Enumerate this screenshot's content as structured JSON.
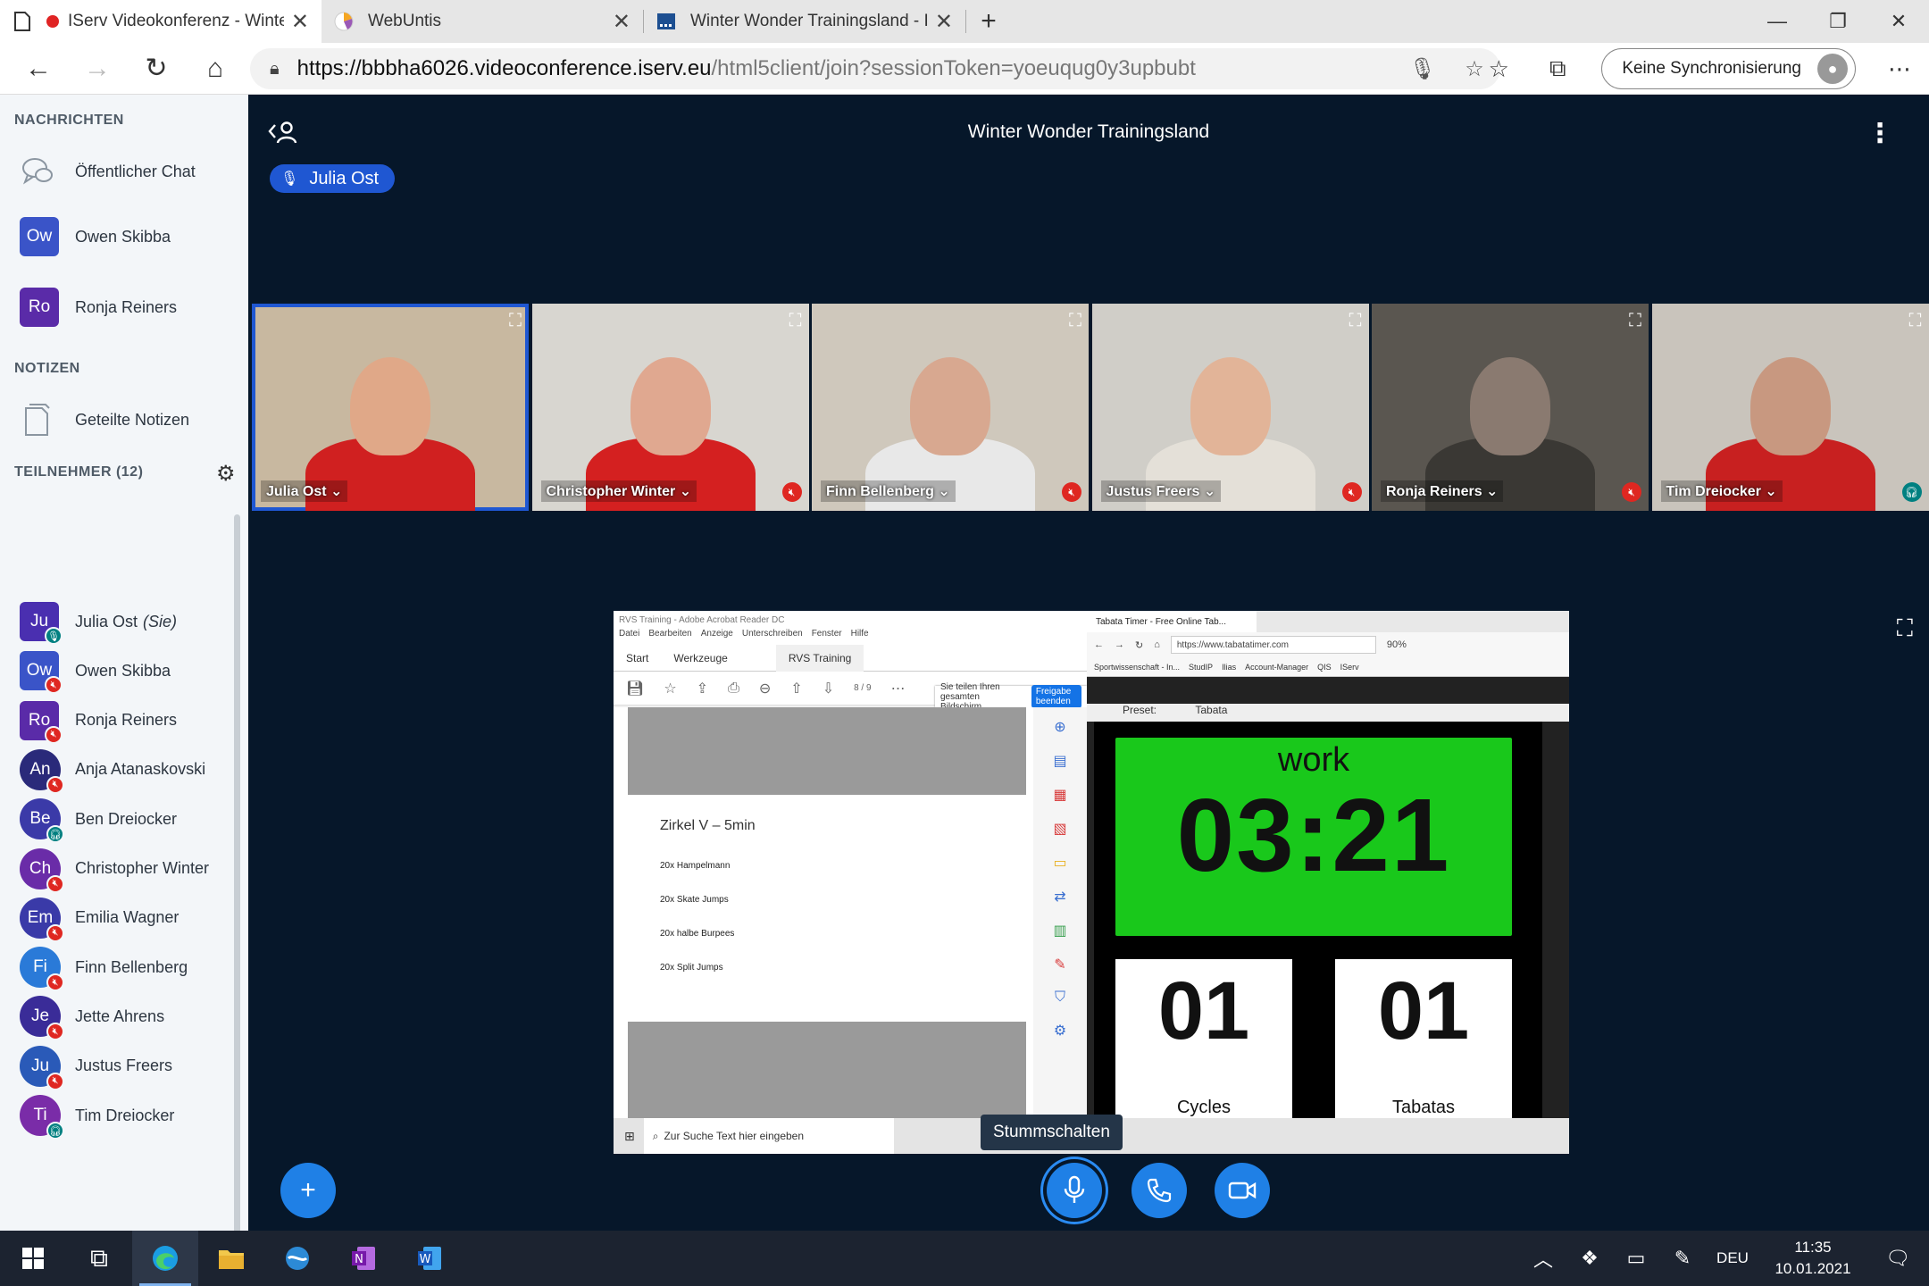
{
  "browser": {
    "tabs": [
      {
        "title": "IServ Videokonferenz - Winter Wonder Trainingsland",
        "active": true
      },
      {
        "title": "WebUntis",
        "active": false
      },
      {
        "title": "Winter Wonder Trainingsland - IServ",
        "active": false
      }
    ],
    "url_host": "https://bbbha6026.videoconference.iserv.eu",
    "url_path": "/html5client/join?sessionToken=yoeuqug0y3upbubt",
    "sync_label": "Keine Synchronisierung"
  },
  "sidebar": {
    "messages_title": "NACHRICHTEN",
    "public_chat": "Öffentlicher Chat",
    "private_chats": [
      {
        "initials": "Ow",
        "name": "Owen Skibba"
      },
      {
        "initials": "Ro",
        "name": "Ronja Reiners"
      }
    ],
    "notes_title": "NOTIZEN",
    "shared_notes": "Geteilte Notizen",
    "participants_title": "TEILNEHMER (12)",
    "participants": [
      {
        "initials": "Ju",
        "name": "Julia Ost",
        "suffix": "(Sie)",
        "color": "#4a2fb0",
        "shape": "square",
        "status": "mic"
      },
      {
        "initials": "Ow",
        "name": "Owen Skibba",
        "color": "#3a54c8",
        "shape": "square",
        "status": "mute"
      },
      {
        "initials": "Ro",
        "name": "Ronja Reiners",
        "color": "#5a2ba8",
        "shape": "square",
        "status": "mute"
      },
      {
        "initials": "An",
        "name": "Anja Atanaskovski",
        "color": "#2a2a7a",
        "shape": "circle",
        "status": "mute"
      },
      {
        "initials": "Be",
        "name": "Ben Dreiocker",
        "color": "#3b3aa8",
        "shape": "circle",
        "status": "head"
      },
      {
        "initials": "Ch",
        "name": "Christopher Winter",
        "color": "#6a2ca8",
        "shape": "circle",
        "status": "mute"
      },
      {
        "initials": "Em",
        "name": "Emilia Wagner",
        "color": "#3a3aa8",
        "shape": "circle",
        "status": "mute"
      },
      {
        "initials": "Fi",
        "name": "Finn Bellenberg",
        "color": "#2a7ad8",
        "shape": "circle",
        "status": "mute"
      },
      {
        "initials": "Je",
        "name": "Jette Ahrens",
        "color": "#3a2c98",
        "shape": "circle",
        "status": "mute"
      },
      {
        "initials": "Ju",
        "name": "Justus Freers",
        "color": "#2a5ab8",
        "shape": "circle",
        "status": "mute"
      },
      {
        "initials": "Ti",
        "name": "Tim Dreiocker",
        "color": "#7a2ca8",
        "shape": "circle",
        "status": "head"
      }
    ]
  },
  "main": {
    "room_title": "Winter Wonder Trainingsland",
    "talker": "Julia Ost",
    "videos": [
      {
        "name": "Julia Ost",
        "status": "none",
        "bg": "#c8b8a0",
        "shirt": "#d02020",
        "skin": "#e0a888",
        "speaking": true
      },
      {
        "name": "Christopher Winter",
        "status": "mute",
        "bg": "#d8d6d0",
        "shirt": "#d42020",
        "skin": "#e0a890",
        "speaking": false
      },
      {
        "name": "Finn Bellenberg",
        "status": "mute",
        "bg": "#cfc8bc",
        "shirt": "#e8e8e8",
        "skin": "#d8a890",
        "speaking": false
      },
      {
        "name": "Justus Freers",
        "status": "mute",
        "bg": "#d0cec8",
        "shirt": "#e4e0d8",
        "skin": "#e2b498",
        "speaking": false
      },
      {
        "name": "Ronja Reiners",
        "status": "mute",
        "bg": "#5a5650",
        "shirt": "#3a3834",
        "skin": "#8a7a70",
        "speaking": false
      },
      {
        "name": "Tim Dreiocker",
        "status": "head",
        "bg": "#c9c4bc",
        "shirt": "#c82020",
        "skin": "#c89880",
        "speaking": false
      }
    ],
    "screenshare": {
      "acrobat_title": "RVS Training - Adobe Acrobat Reader DC",
      "acrobat_menu": [
        "Datei",
        "Bearbeiten",
        "Anzeige",
        "Unterschreiben",
        "Fenster",
        "Hilfe"
      ],
      "acrobat_tabs": [
        "Start",
        "Werkzeuge",
        "RVS Training"
      ],
      "page_indicator": "8 / 9",
      "share_notice": "Sie teilen Ihren gesamten Bildschirm.",
      "share_stop": "Freigabe beenden",
      "pdf_heading": "Zirkel V – 5min",
      "pdf_lines": [
        "20x Hampelmann",
        "20x  Skate Jumps",
        "20x halbe Burpees",
        "20x Split Jumps"
      ],
      "ff_tab": "Tabata Timer - Free Online Tab...",
      "ff_url": "https://www.tabatatimer.com",
      "ff_zoom": "90%",
      "ff_bookmarks": [
        "Sportwissenschaft - In...",
        "StudIP",
        "Ilias",
        "Account-Manager",
        "QIS",
        "IServ"
      ],
      "preset_label": "Preset:",
      "preset_value": "Tabata",
      "timer_phase": "work",
      "timer_value": "03:21",
      "cycles_value": "01",
      "cycles_label": "Cycles",
      "tabatas_value": "01",
      "tabatas_label": "Tabatas",
      "win_search": "Zur Suche Text hier eingeben"
    },
    "tooltip": "Stummschalten"
  },
  "taskbar": {
    "lang": "DEU",
    "time": "11:35",
    "date": "10.01.2021"
  }
}
